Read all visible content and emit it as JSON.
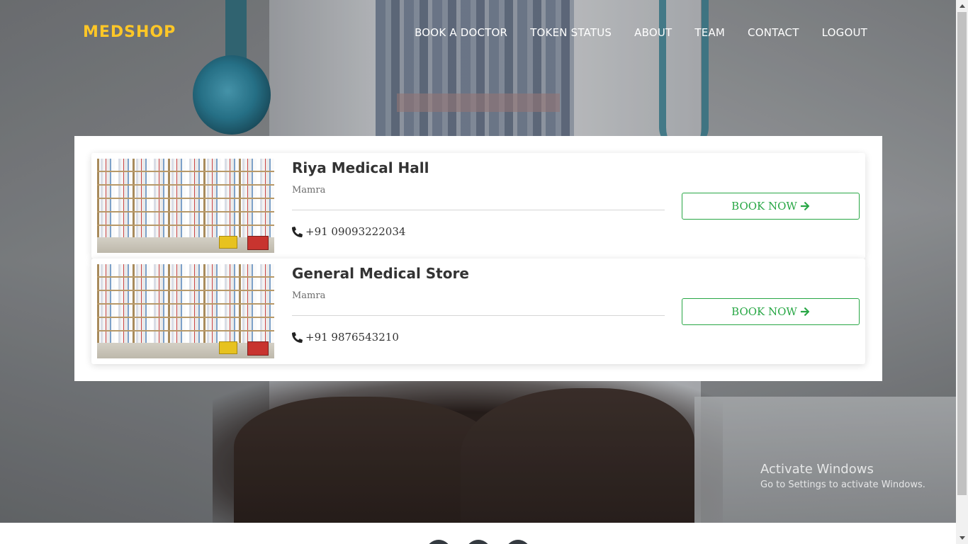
{
  "nav": {
    "brand": "MEDSHOP",
    "links": [
      {
        "label": "BOOK A DOCTOR"
      },
      {
        "label": "TOKEN STATUS"
      },
      {
        "label": "ABOUT"
      },
      {
        "label": "TEAM"
      },
      {
        "label": "CONTACT"
      },
      {
        "label": "LOGOUT"
      }
    ]
  },
  "stores": [
    {
      "name": "Riya Medical Hall",
      "location": "Mamra",
      "phone": "+91 09093222034",
      "button_label": "BOOK NOW",
      "image_icon": "pharmacy-shelves-image"
    },
    {
      "name": "General Medical Store",
      "location": "Mamra",
      "phone": "+91 9876543210",
      "button_label": "BOOK NOW",
      "image_icon": "pharmacy-shelves-image"
    }
  ],
  "watermark": {
    "title": "Activate Windows",
    "subtitle": "Go to Settings to activate Windows."
  },
  "footer": {
    "social_icons": [
      "social-icon",
      "social-icon",
      "social-icon"
    ]
  },
  "colors": {
    "brand": "#ffc727",
    "accent": "#28a745",
    "nav_text": "#ffffff"
  }
}
